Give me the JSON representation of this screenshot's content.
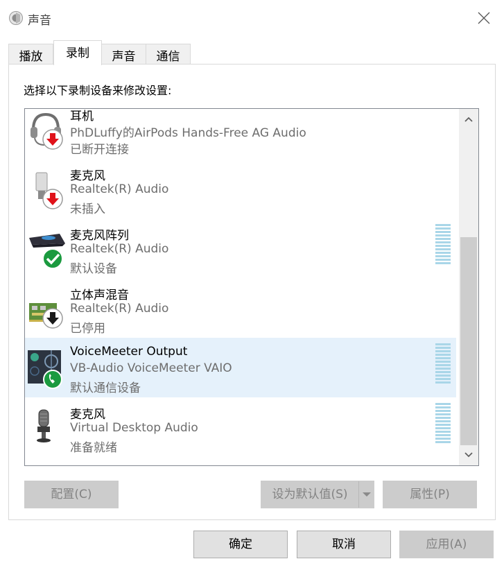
{
  "window": {
    "title": "声音",
    "icon": "speaker-icon",
    "close_icon": "close-icon"
  },
  "tabs": [
    {
      "label": "播放",
      "active": false
    },
    {
      "label": "录制",
      "active": true
    },
    {
      "label": "声音",
      "active": false
    },
    {
      "label": "通信",
      "active": false
    }
  ],
  "instruction": "选择以下录制设备来修改设置:",
  "devices": [
    {
      "name": "耳机",
      "sub": "PhDLuffy的AirPods Hands-Free AG Audio",
      "status": "已断开连接",
      "icon": "headset-icon",
      "badge": "disconnected-red-arrow-icon",
      "level_meter": false,
      "selected": false
    },
    {
      "name": "麦克风",
      "sub": "Realtek(R) Audio",
      "status": "未插入",
      "icon": "microphone-icon",
      "badge": "unplugged-red-arrow-icon",
      "level_meter": false,
      "selected": false
    },
    {
      "name": "麦克风阵列",
      "sub": "Realtek(R) Audio",
      "status": "默认设备",
      "icon": "microphone-array-icon",
      "badge": "default-checkmark-icon",
      "level_meter": true,
      "selected": false
    },
    {
      "name": "立体声混音",
      "sub": "Realtek(R) Audio",
      "status": "已停用",
      "icon": "sound-card-icon",
      "badge": "disabled-down-arrow-icon",
      "level_meter": false,
      "selected": false
    },
    {
      "name": "VoiceMeeter Output",
      "sub": "VB-Audio VoiceMeeter VAIO",
      "status": "默认通信设备",
      "icon": "voicemeeter-icon",
      "badge": "communications-phone-icon",
      "level_meter": true,
      "selected": true
    },
    {
      "name": "麦克风",
      "sub": "Virtual Desktop Audio",
      "status": "准备就绪",
      "icon": "studio-microphone-icon",
      "badge": "",
      "level_meter": true,
      "selected": false
    }
  ],
  "buttons": {
    "configure": "配置(C)",
    "set_default": "设为默认值(S)",
    "properties": "属性(P)",
    "ok": "确定",
    "cancel": "取消",
    "apply": "应用(A)"
  },
  "colors": {
    "selected_row": "#e5f1fb",
    "meter": "#a9d6e8",
    "status_text": "#6d6d6d",
    "disabled_button": "#cccccc"
  }
}
